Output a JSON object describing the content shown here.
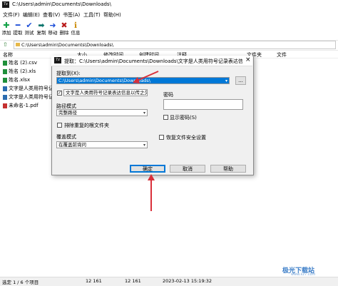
{
  "window": {
    "title": "C:\\Users\\admin\\Documents\\Downloads\\",
    "app_icon_text": "7z"
  },
  "menu": [
    "文件(F)",
    "编辑(E)",
    "查看(V)",
    "书签(A)",
    "工具(T)",
    "帮助(H)"
  ],
  "toolbar": [
    {
      "label": "添加",
      "icon": "plus-icon",
      "glyph": "✚",
      "color": "#16a34a"
    },
    {
      "label": "提取",
      "icon": "minus-icon",
      "glyph": "━",
      "color": "#1d4ed8"
    },
    {
      "label": "测试",
      "icon": "check-icon",
      "glyph": "✔",
      "color": "#1d4ed8"
    },
    {
      "label": "复制",
      "icon": "copy-arrow-icon",
      "glyph": "➡",
      "color": "#0f766e"
    },
    {
      "label": "移动",
      "icon": "move-arrow-icon",
      "glyph": "➜",
      "color": "#1d4ed8"
    },
    {
      "label": "删除",
      "icon": "delete-x-icon",
      "glyph": "✖",
      "color": "#b91c1c"
    },
    {
      "label": "信息",
      "icon": "info-icon",
      "glyph": "ℹ",
      "color": "#ca8a04"
    }
  ],
  "address": {
    "path": "C:\\Users\\admin\\Documents\\Downloads\\"
  },
  "columns": {
    "name": "名称",
    "size": "大小",
    "modified": "修改时间",
    "created": "创建时间",
    "comment": "注释",
    "folder": "文件夹",
    "files": "文件"
  },
  "files": [
    {
      "name": "姓名 (2).csv",
      "icon_color": "#1f8f3a"
    },
    {
      "name": "姓名 (2).xls",
      "icon_color": "#1f8f3a"
    },
    {
      "name": "姓名.xlsx",
      "icon_color": "#1f8f3a"
    },
    {
      "name": "文字是人类用符号记",
      "icon_color": "#2b6cb0"
    },
    {
      "name": "文字是人类用符号记",
      "icon_color": "#2b6cb0"
    },
    {
      "name": "未命名-1.pdf",
      "icon_color": "#c53030"
    }
  ],
  "status": {
    "selection": "选定 1 / 6 个项目",
    "size1": "12 161",
    "size2": "12 161",
    "datetime": "2023-02-13 15:19:32"
  },
  "dialog": {
    "title": "提取：C:\\Users\\admin\\Documents\\Downloads\\文字是人类用符号记录表达信息以传...",
    "icon_text": "7z",
    "extract_to_label": "提取到(X):",
    "extract_to_value": "C:\\Users\\admin\\Documents\\Downloads\\",
    "browse_label": "...",
    "subfolder_value": "文字是人类用符号记录表达信息以传之久",
    "subfolder_checked": true,
    "path_mode_label": "路径模式",
    "path_mode_value": "完整路径",
    "eliminate_dup_label": "排除重复的根文件夹",
    "overwrite_label": "覆盖模式",
    "overwrite_value": "在覆盖前询问",
    "password_label": "密码",
    "show_password_label": "显示密码(S)",
    "restore_security_label": "恢复文件安全设置",
    "ok_label": "确定",
    "cancel_label": "取消",
    "help_label": "帮助"
  },
  "watermark": {
    "text": "极光下载站",
    "sub": "www.xz7.com"
  },
  "annotation_color": "#d9303a"
}
